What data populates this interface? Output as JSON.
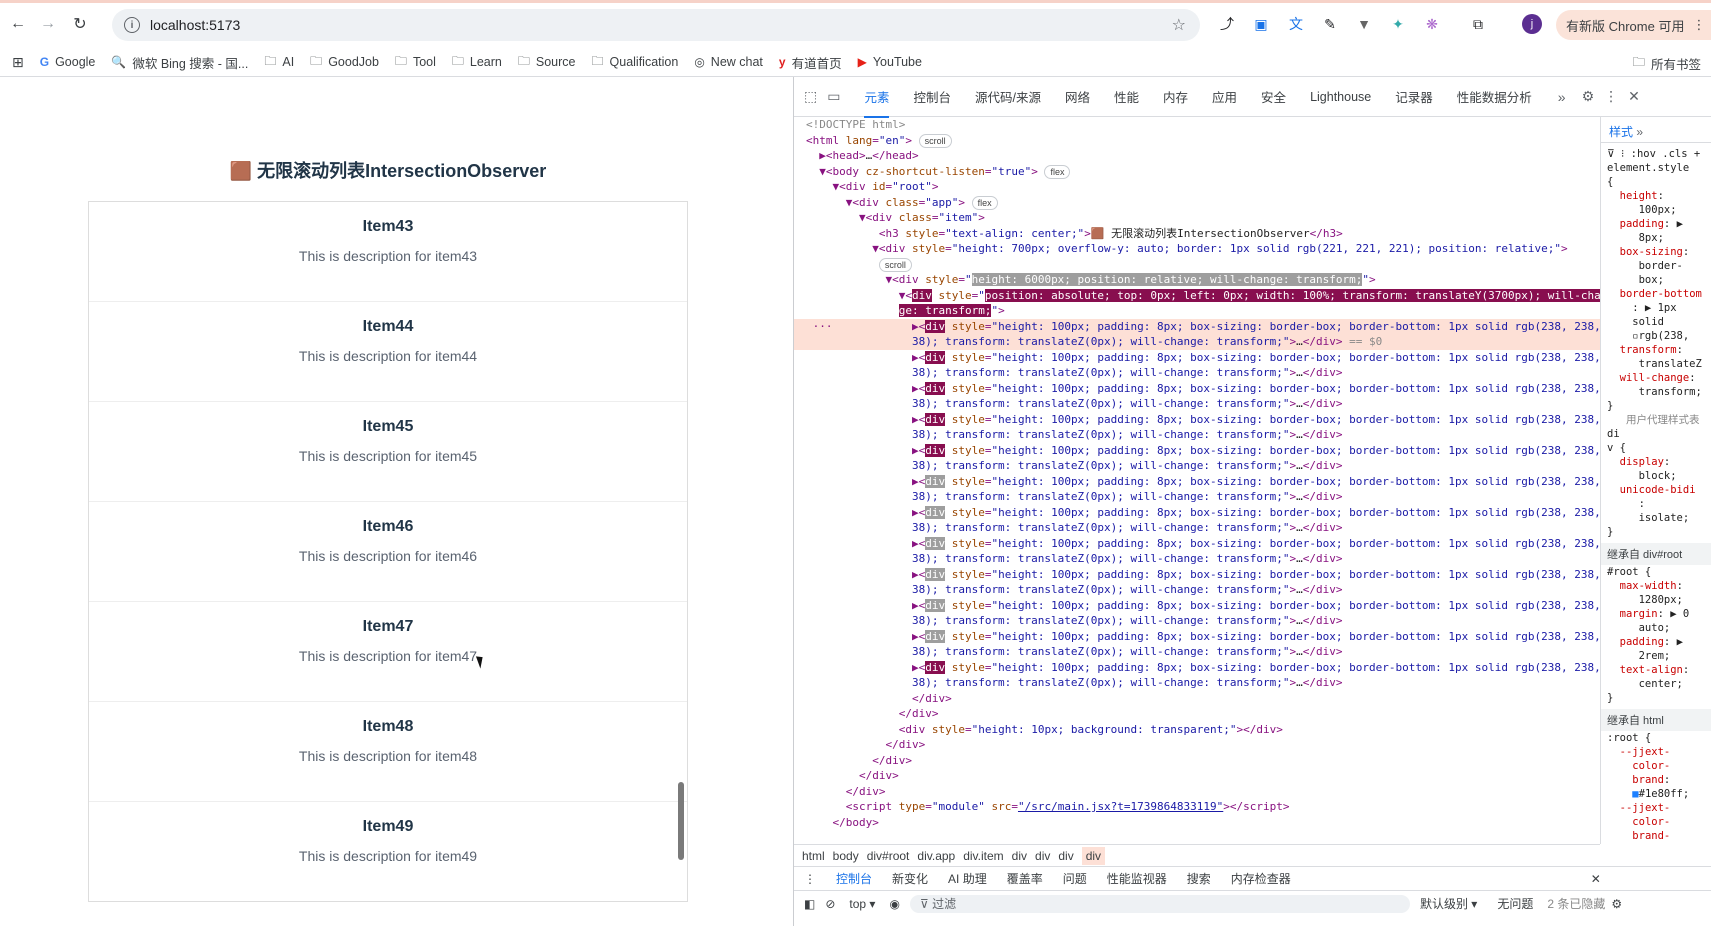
{
  "browser": {
    "url": "localhost:5173",
    "update_label": "有新版 Chrome 可用",
    "avatar_letter": "j",
    "bookmarks": [
      {
        "label": "Google",
        "icon": "G"
      },
      {
        "label": "微软 Bing 搜索 - 国...",
        "icon": "🔍"
      },
      {
        "label": "AI",
        "icon": "📁"
      },
      {
        "label": "GoodJob",
        "icon": "📁"
      },
      {
        "label": "Tool",
        "icon": "📁"
      },
      {
        "label": "Learn",
        "icon": "📁"
      },
      {
        "label": "Source",
        "icon": "📁"
      },
      {
        "label": "Qualification",
        "icon": "📁"
      },
      {
        "label": "New chat",
        "icon": "◎"
      },
      {
        "label": "有道首页",
        "icon": "y"
      },
      {
        "label": "YouTube",
        "icon": "▶"
      }
    ],
    "all_bookmarks": "所有书签"
  },
  "app": {
    "title": "🟫 无限滚动列表IntersectionObserver",
    "items": [
      {
        "title": "Item43",
        "desc": "This is description for item43"
      },
      {
        "title": "Item44",
        "desc": "This is description for item44"
      },
      {
        "title": "Item45",
        "desc": "This is description for item45"
      },
      {
        "title": "Item46",
        "desc": "This is description for item46"
      },
      {
        "title": "Item47",
        "desc": "This is description for item47"
      },
      {
        "title": "Item48",
        "desc": "This is description for item48"
      },
      {
        "title": "Item49",
        "desc": "This is description for item49"
      }
    ]
  },
  "devtools": {
    "tabs": [
      "元素",
      "控制台",
      "源代码/来源",
      "网络",
      "性能",
      "内存",
      "应用",
      "安全",
      "Lighthouse",
      "记录器",
      "性能数据分析"
    ],
    "active_tab": "元素",
    "breadcrumbs": [
      "html",
      "body",
      "div#root",
      "div.app",
      "div.item",
      "div",
      "div",
      "div",
      "div"
    ],
    "console_tabs": [
      "控制台",
      "新变化",
      "AI 助理",
      "覆盖率",
      "问题",
      "性能监视器",
      "搜索",
      "内存检查器"
    ],
    "console_context": "top",
    "filter_placeholder": "过滤",
    "level": "默认级别",
    "issues": "无问题",
    "hidden": "2 条已隐藏",
    "styles_tab": "样式"
  }
}
